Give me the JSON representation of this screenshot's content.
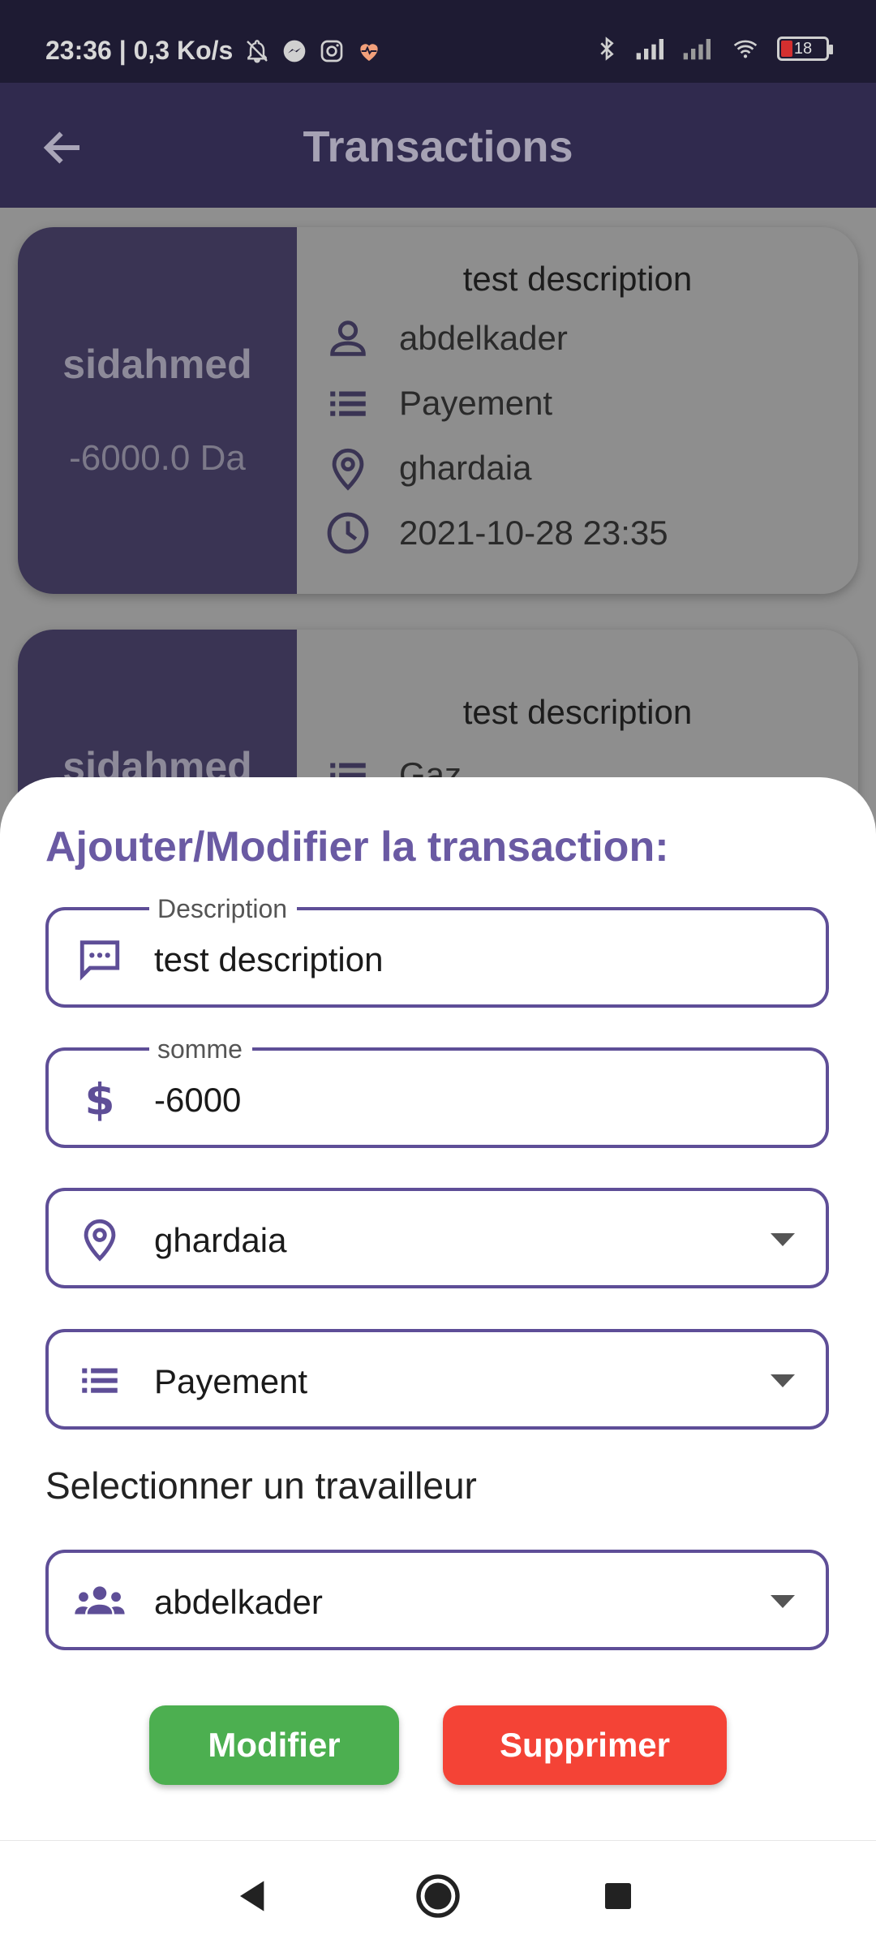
{
  "status_bar": {
    "time_speed": "23:36 | 0,3 Ko/s",
    "battery": "18"
  },
  "app_bar": {
    "title": "Transactions"
  },
  "cards": [
    {
      "name": "sidahmed",
      "amount": "-6000.0 Da",
      "description": "test description",
      "worker": "abdelkader",
      "category": "Payement",
      "location": "ghardaia",
      "datetime": "2021-10-28 23:35"
    },
    {
      "name": "sidahmed",
      "description": "test description",
      "category": "Gaz"
    }
  ],
  "sheet": {
    "title": "Ajouter/Modifier la transaction:",
    "description_label": "Description",
    "description_value": "test description",
    "amount_label": "somme",
    "amount_value": "-6000",
    "location_value": "ghardaia",
    "category_value": "Payement",
    "worker_section_label": "Selectionner un travailleur",
    "worker_value": "abdelkader",
    "modify_label": "Modifier",
    "delete_label": "Supprimer"
  },
  "colors": {
    "accent": "#5e4e97",
    "modify": "#4caf50",
    "delete": "#f44336"
  }
}
